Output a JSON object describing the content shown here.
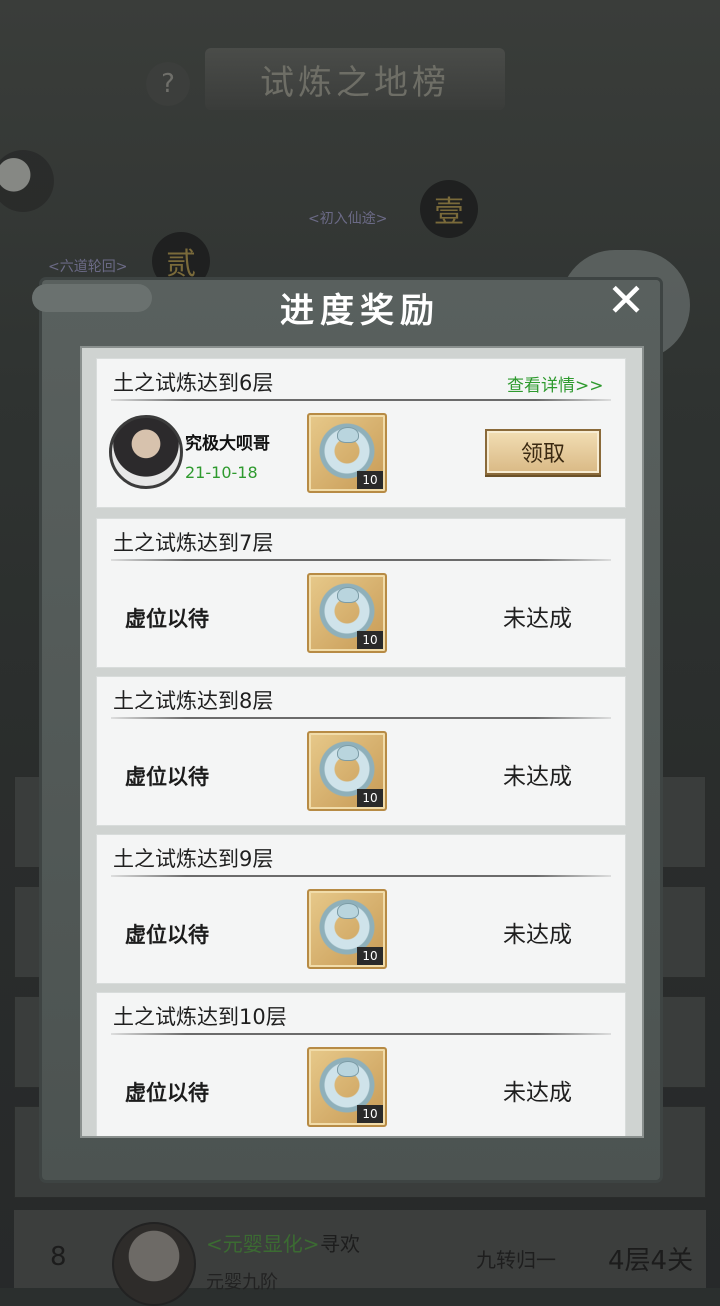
{
  "background": {
    "leaderboard_title": "试炼之地榜",
    "help_label": "?",
    "stage_one_char": "壹",
    "stage_two_char": "贰",
    "tag_left": "<六道轮回>",
    "tag_center": "<初入仙途>",
    "bottom_row": {
      "rank": "8",
      "realm": "<元婴显化>",
      "player": "寻欢",
      "stage": "元婴九阶",
      "title": "九转归一",
      "level": "4层4关"
    }
  },
  "modal": {
    "title": "进度奖励",
    "close_label": "✕",
    "cards": [
      {
        "title": "土之试炼达到6层",
        "details_link": "查看详情>>",
        "achiever_name": "究极大呗哥",
        "achiever_date": "21-10-18",
        "reward_count": "10",
        "claim_label": "领取"
      },
      {
        "title": "土之试炼达到7层",
        "placeholder": "虚位以待",
        "reward_count": "10",
        "status": "未达成"
      },
      {
        "title": "土之试炼达到8层",
        "placeholder": "虚位以待",
        "reward_count": "10",
        "status": "未达成"
      },
      {
        "title": "土之试炼达到9层",
        "placeholder": "虚位以待",
        "reward_count": "10",
        "status": "未达成"
      },
      {
        "title": "土之试炼达到10层",
        "placeholder": "虚位以待",
        "reward_count": "10",
        "status": "未达成"
      }
    ]
  },
  "colors": {
    "link_green": "#2e9a2e",
    "claim_button": "#e6cc9c",
    "overlay": "#2b2f2e"
  }
}
